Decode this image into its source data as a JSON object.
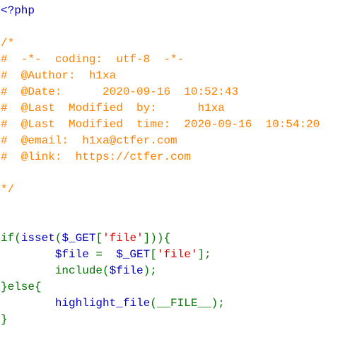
{
  "code": {
    "lines": [
      [
        {
          "t": "<?php",
          "c": "default"
        }
      ],
      [],
      [
        {
          "t": "/*",
          "c": "comment"
        }
      ],
      [
        {
          "t": "#  -*-  coding:  utf-8  -*-",
          "c": "comment"
        }
      ],
      [
        {
          "t": "#  @Author:  h1xa",
          "c": "comment"
        }
      ],
      [
        {
          "t": "#  @Date:      2020-09-16  10:52:43",
          "c": "comment"
        }
      ],
      [
        {
          "t": "#  @Last  Modified  by:      h1xa",
          "c": "comment"
        }
      ],
      [
        {
          "t": "#  @Last  Modified  time:  2020-09-16  10:54:20",
          "c": "comment"
        }
      ],
      [
        {
          "t": "#  @email:  h1xa@ctfer.com",
          "c": "comment"
        }
      ],
      [
        {
          "t": "#  @link:  https://ctfer.com",
          "c": "comment"
        }
      ],
      [],
      [
        {
          "t": "*/",
          "c": "comment"
        }
      ],
      [],
      [],
      [
        {
          "t": "if(",
          "c": "keyword"
        },
        {
          "t": "isset",
          "c": "default"
        },
        {
          "t": "(",
          "c": "keyword"
        },
        {
          "t": "$_GET",
          "c": "default"
        },
        {
          "t": "[",
          "c": "keyword"
        },
        {
          "t": "'file'",
          "c": "string"
        },
        {
          "t": "])){",
          "c": "keyword"
        }
      ],
      [
        {
          "t": "        ",
          "c": "keyword"
        },
        {
          "t": "$file ",
          "c": "default"
        },
        {
          "t": "= ",
          "c": "keyword"
        },
        {
          "t": " $_GET",
          "c": "default"
        },
        {
          "t": "[",
          "c": "keyword"
        },
        {
          "t": "'file'",
          "c": "string"
        },
        {
          "t": "];",
          "c": "keyword"
        }
      ],
      [
        {
          "t": "        ",
          "c": "keyword"
        },
        {
          "t": "include(",
          "c": "keyword"
        },
        {
          "t": "$file",
          "c": "default"
        },
        {
          "t": ");",
          "c": "keyword"
        }
      ],
      [
        {
          "t": "}else{",
          "c": "keyword"
        }
      ],
      [
        {
          "t": "        ",
          "c": "keyword"
        },
        {
          "t": "highlight_file",
          "c": "default"
        },
        {
          "t": "(",
          "c": "keyword"
        },
        {
          "t": "__FILE__",
          "c": "keyword"
        },
        {
          "t": ");",
          "c": "keyword"
        }
      ],
      [
        {
          "t": "}",
          "c": "keyword"
        }
      ]
    ]
  }
}
